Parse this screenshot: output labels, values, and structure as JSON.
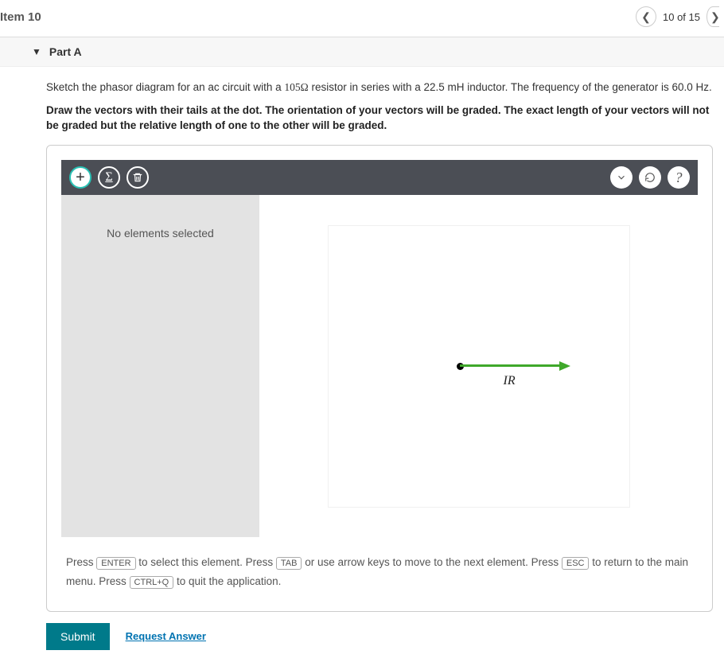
{
  "header": {
    "title": "Item 10",
    "progress": "10 of 15"
  },
  "part": {
    "caret": "▼",
    "label": "Part A"
  },
  "question": {
    "pre": "Sketch the phasor diagram for an ac circuit with a ",
    "resistor": "105Ω",
    "mid1": " resistor in series with a ",
    "inductance": "22.5 mH",
    "mid2": " inductor. The frequency of the generator is ",
    "freq": "60.0 Hz",
    "end": "."
  },
  "instruction": "Draw the vectors with their tails at the dot. The orientation of your vectors will be graded. The exact length of your vectors will not be graded but the relative length of one to the other will be graded.",
  "toolbar": {
    "add": "+",
    "sigma": "Σ"
  },
  "sidebar": {
    "empty": "No elements selected"
  },
  "canvas": {
    "vector_label": "IR"
  },
  "hints": {
    "t1": "Press ",
    "k1": "ENTER",
    "t2": " to select this element. Press ",
    "k2": "TAB",
    "t3": " or use arrow keys to move to the next element. Press ",
    "k3": "ESC",
    "t4": " to return to the main menu. Press ",
    "k4": "CTRL+Q",
    "t5": " to quit the application."
  },
  "actions": {
    "submit": "Submit",
    "request": "Request Answer"
  }
}
